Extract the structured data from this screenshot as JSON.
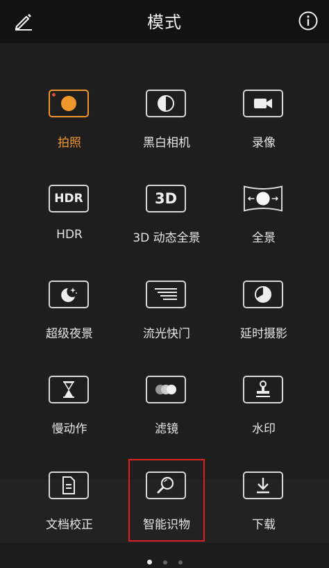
{
  "header": {
    "title": "模式",
    "edit_icon": "pencil-icon",
    "info_icon": "info-icon"
  },
  "modes": [
    {
      "label": "拍照",
      "icon": "camera-shutter-icon",
      "active": true
    },
    {
      "label": "黑白相机",
      "icon": "half-circle-icon"
    },
    {
      "label": "录像",
      "icon": "video-camera-icon"
    },
    {
      "label": "HDR",
      "icon": "hdr-icon",
      "icon_text": "HDR"
    },
    {
      "label": "3D 动态全景",
      "icon": "3d-icon",
      "icon_text": "3D"
    },
    {
      "label": "全景",
      "icon": "panorama-icon"
    },
    {
      "label": "超级夜景",
      "icon": "moon-stars-icon"
    },
    {
      "label": "流光快门",
      "icon": "light-streak-icon"
    },
    {
      "label": "延时摄影",
      "icon": "timelapse-icon"
    },
    {
      "label": "慢动作",
      "icon": "hourglass-icon"
    },
    {
      "label": "滤镜",
      "icon": "filter-circles-icon"
    },
    {
      "label": "水印",
      "icon": "stamp-icon"
    },
    {
      "label": "文档校正",
      "icon": "document-icon"
    },
    {
      "label": "智能识物",
      "icon": "magnifier-icon"
    },
    {
      "label": "下载",
      "icon": "download-icon"
    }
  ],
  "pager": {
    "pages": 3,
    "current": 1
  },
  "colors": {
    "accent": "#f0972c",
    "highlight": "#e02020",
    "background": "#1e1e1e"
  }
}
